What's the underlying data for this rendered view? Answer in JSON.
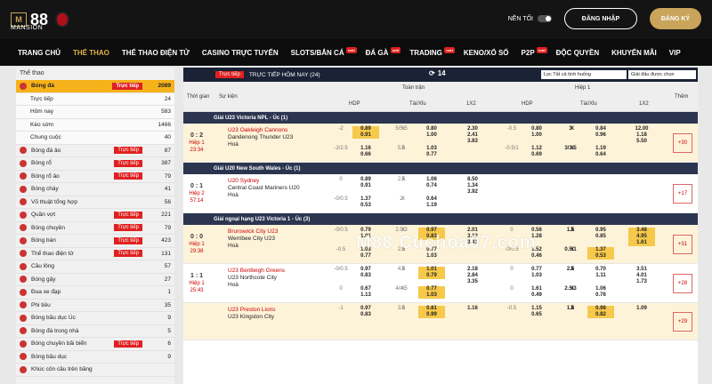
{
  "brand": {
    "logo_mark": "M",
    "logo_number": "88",
    "logo_sub": "MANSION"
  },
  "header": {
    "dark_mode_label": "NỀN TỐI",
    "login_label": "ĐĂNG NHẬP",
    "register_label": "ĐĂNG KÝ"
  },
  "nav": [
    {
      "label": "TRANG CHỦ",
      "badge": ""
    },
    {
      "label": "THỂ THAO",
      "badge": ""
    },
    {
      "label": "THỂ THAO ĐIỆN TỬ",
      "badge": ""
    },
    {
      "label": "CASINO TRỰC TUYẾN",
      "badge": ""
    },
    {
      "label": "SLOTS/BẮN CÁ",
      "badge": "mới"
    },
    {
      "label": "ĐÁ GÀ",
      "badge": "mới"
    },
    {
      "label": "TRADING",
      "badge": "mới"
    },
    {
      "label": "KENO/XỔ SỐ",
      "badge": ""
    },
    {
      "label": "P2P",
      "badge": "mới"
    },
    {
      "label": "ĐỘC QUYỀN",
      "badge": ""
    },
    {
      "label": "KHUYẾN MÃI",
      "badge": ""
    },
    {
      "label": "VIP",
      "badge": ""
    }
  ],
  "sidebar": {
    "title": "Thể thao",
    "items": [
      {
        "label": "Bóng đá",
        "live": "Trực tiếp",
        "count": "2089",
        "kind": "active"
      },
      {
        "label": "Trực tiếp",
        "live": "",
        "count": "24",
        "kind": "sub"
      },
      {
        "label": "Hôm nay",
        "live": "",
        "count": "583",
        "kind": "sub"
      },
      {
        "label": "Kèo sớm",
        "live": "",
        "count": "1466",
        "kind": "sub"
      },
      {
        "label": "Chung cuộc",
        "live": "",
        "count": "40",
        "kind": "sub"
      },
      {
        "label": "Bóng đá ảo",
        "live": "Trực tiếp",
        "count": "87",
        "kind": ""
      },
      {
        "label": "Bóng rổ",
        "live": "Trực tiếp",
        "count": "387",
        "kind": ""
      },
      {
        "label": "Bóng rổ ảo",
        "live": "Trực tiếp",
        "count": "79",
        "kind": ""
      },
      {
        "label": "Bóng chày",
        "live": "",
        "count": "41",
        "kind": ""
      },
      {
        "label": "Võ thuật tổng hợp",
        "live": "",
        "count": "56",
        "kind": ""
      },
      {
        "label": "Quần vợt",
        "live": "Trực tiếp",
        "count": "221",
        "kind": ""
      },
      {
        "label": "Bóng chuyền",
        "live": "Trực tiếp",
        "count": "79",
        "kind": ""
      },
      {
        "label": "Bóng bàn",
        "live": "Trực tiếp",
        "count": "423",
        "kind": ""
      },
      {
        "label": "Thể thao điện tử",
        "live": "Trực tiếp",
        "count": "131",
        "kind": ""
      },
      {
        "label": "Cầu lông",
        "live": "",
        "count": "57",
        "kind": ""
      },
      {
        "label": "Bóng gậy",
        "live": "",
        "count": "27",
        "kind": ""
      },
      {
        "label": "Đua xe đạp",
        "live": "",
        "count": "1",
        "kind": ""
      },
      {
        "label": "Phi tiêu",
        "live": "",
        "count": "35",
        "kind": ""
      },
      {
        "label": "Bóng bầu dục Úc",
        "live": "",
        "count": "9",
        "kind": ""
      },
      {
        "label": "Bóng đá trong nhà",
        "live": "",
        "count": "5",
        "kind": ""
      },
      {
        "label": "Bóng chuyền bãi biển",
        "live": "Trực tiếp",
        "count": "6",
        "kind": ""
      },
      {
        "label": "Bóng bầu dục",
        "live": "",
        "count": "9",
        "kind": ""
      },
      {
        "label": "Khúc côn cầu trên băng",
        "live": "",
        "count": "",
        "kind": ""
      }
    ]
  },
  "main": {
    "live_label": "Trực tiếp",
    "title": "TRỰC TIẾP HÔM NAY (24)",
    "count": "14",
    "filter": "Lọc Tất cả tình huống",
    "filter2": "Giải đấu được chọn",
    "columns": {
      "time": "Thời gian",
      "event": "Sự kiện",
      "full": "Toàn trận",
      "half": "Hiệp 1",
      "more": "Thêm",
      "hdp": "HDP",
      "ou": "Tài/Xỉu",
      "x12": "1X2"
    }
  },
  "leagues": [
    {
      "name": "Giải U23 Victoria NPL - Úc (1)",
      "matches": [
        {
          "score": "0 : 2",
          "period": "Hiệp 1",
          "clock": "23:34",
          "home": "U23 Oakleigh Cannons",
          "away": "Dandenong Thunder U23",
          "draw": "Hoà",
          "more": "+30",
          "hl": true,
          "rows": [
            {
              "hdp_l": "-2",
              "hdp_o": "0.89",
              "hdp_o2": "0.91",
              "ou_l": "5/5.5",
              "ou_x": "X",
              "ou_o": "0.80",
              "ou_o2": "1.00",
              "x1": "2.30",
              "x2": "2.41",
              "x3": "3.83",
              "h_hdp_l": "-0.5",
              "h_hdp_o": "0.80",
              "h_hdp_o2": "1.00",
              "h_ou_l": "3",
              "h_ou_x": "X",
              "h_ou_o": "0.84",
              "h_ou_o2": "0.96",
              "h_x1": "12.00",
              "h_x2": "1.18",
              "h_x3": "5.50",
              "hi": [
                "hdp_o",
                "hdp_o2"
              ]
            },
            {
              "hdp_l": "-2/2.5",
              "hdp_o": "1.16",
              "hdp_o2": "0.66",
              "ou_l": "5.5",
              "ou_x": "X",
              "ou_o": "1.03",
              "ou_o2": "0.77",
              "x1": "",
              "x2": "",
              "x3": "",
              "h_hdp_l": "-0.5/1",
              "h_hdp_o": "1.12",
              "h_hdp_o2": "0.69",
              "h_ou_l": "3/3.5",
              "h_ou_x": "X",
              "h_ou_o": "1.19",
              "h_ou_o2": "0.64",
              "h_x1": "",
              "h_x2": "",
              "h_x3": "",
              "hi": []
            }
          ]
        }
      ]
    },
    {
      "name": "Giải U20 New South Wales - Úc (1)",
      "matches": [
        {
          "score": "0 : 1",
          "period": "Hiệp 2",
          "clock": "57:14",
          "home": "U20 Sydney",
          "away": "Central Coast Mariners U20",
          "draw": "Hoà",
          "more": "+17",
          "hl": false,
          "rows": [
            {
              "hdp_l": "0",
              "hdp_o": "0.89",
              "hdp_o2": "0.91",
              "ou_l": "2.5",
              "ou_x": "X",
              "ou_o": "1.06",
              "ou_o2": "0.74",
              "x1": "8.50",
              "x2": "1.34",
              "x3": "3.92",
              "h_hdp_l": "",
              "h_hdp_o": "",
              "h_hdp_o2": "",
              "h_ou_l": "",
              "h_ou_x": "",
              "h_ou_o": "",
              "h_ou_o2": "",
              "h_x1": "",
              "h_x2": "",
              "h_x3": "",
              "hi": []
            },
            {
              "hdp_l": "-0/0.5",
              "hdp_o": "1.37",
              "hdp_o2": "0.53",
              "ou_l": "2",
              "ou_x": "X",
              "ou_o": "0.64",
              "ou_o2": "1.19",
              "x1": "",
              "x2": "",
              "x3": "",
              "h_hdp_l": "",
              "h_hdp_o": "",
              "h_hdp_o2": "",
              "h_ou_l": "",
              "h_ou_x": "",
              "h_ou_o": "",
              "h_ou_o2": "",
              "h_x1": "",
              "h_x2": "",
              "h_x3": "",
              "hi": []
            }
          ]
        }
      ]
    },
    {
      "name": "Giải ngoại hạng U23 Victoria 1 - Úc (3)",
      "matches": [
        {
          "score": "0 : 0",
          "period": "Hiệp 1",
          "clock": "29:38",
          "home": "Brunswick City U23",
          "away": "Werribee City U23",
          "draw": "Hoà",
          "more": "+31",
          "hl": true,
          "rows": [
            {
              "hdp_l": "-0/0.5",
              "hdp_o": "0.79",
              "hdp_o2": "1.01",
              "ou_l": "2.5/3",
              "ou_x": "X",
              "ou_o": "0.97",
              "ou_o2": "0.83",
              "x1": "2.01",
              "x2": "3.12",
              "x3": "3.41",
              "h_hdp_l": "0",
              "h_hdp_o": "0.56",
              "h_hdp_o2": "1.28",
              "h_ou_l": "1.5",
              "h_ou_x": "X",
              "h_ou_o": "0.95",
              "h_ou_o2": "0.85",
              "h_x1": "3.48",
              "h_x2": "4.95",
              "h_x3": "1.61",
              "hi": [
                "ou_o",
                "ou_o2",
                "h_x1",
                "h_x2",
                "h_x3"
              ]
            },
            {
              "hdp_l": "-0.5",
              "hdp_o": "1.03",
              "hdp_o2": "0.77",
              "ou_l": "2.5",
              "ou_x": "X",
              "ou_o": "0.77",
              "ou_o2": "1.03",
              "x1": "",
              "x2": "",
              "x3": "",
              "h_hdp_l": "-0/0.5",
              "h_hdp_o": "1.52",
              "h_hdp_o2": "0.46",
              "h_ou_l": "0.5/1",
              "h_ou_x": "X",
              "h_ou_o": "1.37",
              "h_ou_o2": "0.53",
              "h_x1": "",
              "h_x2": "",
              "h_x3": "",
              "hi": [
                "h_ou_o",
                "h_ou_o2"
              ]
            }
          ]
        },
        {
          "score": "1 : 1",
          "period": "Hiệp 1",
          "clock": "25:43",
          "home": "U23 Bentleigh Greens",
          "away": "U23 Northcote City",
          "draw": "Hoà",
          "more": "+28",
          "hl": false,
          "rows": [
            {
              "hdp_l": "-0/0.5",
              "hdp_o": "0.97",
              "hdp_o2": "0.83",
              "ou_l": "4.5",
              "ou_x": "X",
              "ou_o": "1.01",
              "ou_o2": "0.79",
              "x1": "2.18",
              "x2": "2.84",
              "x3": "3.35",
              "h_hdp_l": "0",
              "h_hdp_o": "0.77",
              "h_hdp_o2": "1.03",
              "h_ou_l": "2.5",
              "h_ou_x": "X",
              "h_ou_o": "0.70",
              "h_ou_o2": "1.11",
              "h_x1": "3.51",
              "h_x2": "4.01",
              "h_x3": "1.73",
              "hi": [
                "ou_o",
                "ou_o2"
              ]
            },
            {
              "hdp_l": "0",
              "hdp_o": "0.67",
              "hdp_o2": "1.13",
              "ou_l": "4/4.5",
              "ou_x": "X",
              "ou_o": "0.77",
              "ou_o2": "1.03",
              "x1": "",
              "x2": "",
              "x3": "",
              "h_hdp_l": "0",
              "h_hdp_o": "1.61",
              "h_hdp_o2": "0.49",
              "h_ou_l": "2.5/3",
              "h_ou_x": "X",
              "h_ou_o": "1.06",
              "h_ou_o2": "0.76",
              "h_x1": "",
              "h_x2": "",
              "h_x3": "",
              "hi": [
                "ou_o",
                "ou_o2"
              ]
            }
          ]
        },
        {
          "score": "",
          "period": "",
          "clock": "",
          "home": "U23 Preston Lions",
          "away": "U23 Kingston City",
          "draw": "",
          "more": "+29",
          "hl": true,
          "rows": [
            {
              "hdp_l": "-1",
              "hdp_o": "0.97",
              "hdp_o2": "0.83",
              "ou_l": "3.5",
              "ou_x": "X",
              "ou_o": "0.81",
              "ou_o2": "0.99",
              "x1": "1.16",
              "x2": "",
              "x3": "",
              "h_hdp_l": "-0.5",
              "h_hdp_o": "1.15",
              "h_hdp_o2": "0.65",
              "h_ou_l": "1.5",
              "h_ou_x": "X",
              "h_ou_o": "0.98",
              "h_ou_o2": "0.82",
              "h_x1": "1.09",
              "h_x2": "",
              "h_x3": "",
              "hi": [
                "ou_o",
                "ou_o2",
                "h_ou_o",
                "h_ou_o2"
              ]
            }
          ]
        }
      ]
    }
  ],
  "watermark": "M88 Cuchoa07.com",
  "colors": {
    "accent": "#f6b21a",
    "live": "#e02020",
    "header": "#141414",
    "league": "#2c3550"
  }
}
